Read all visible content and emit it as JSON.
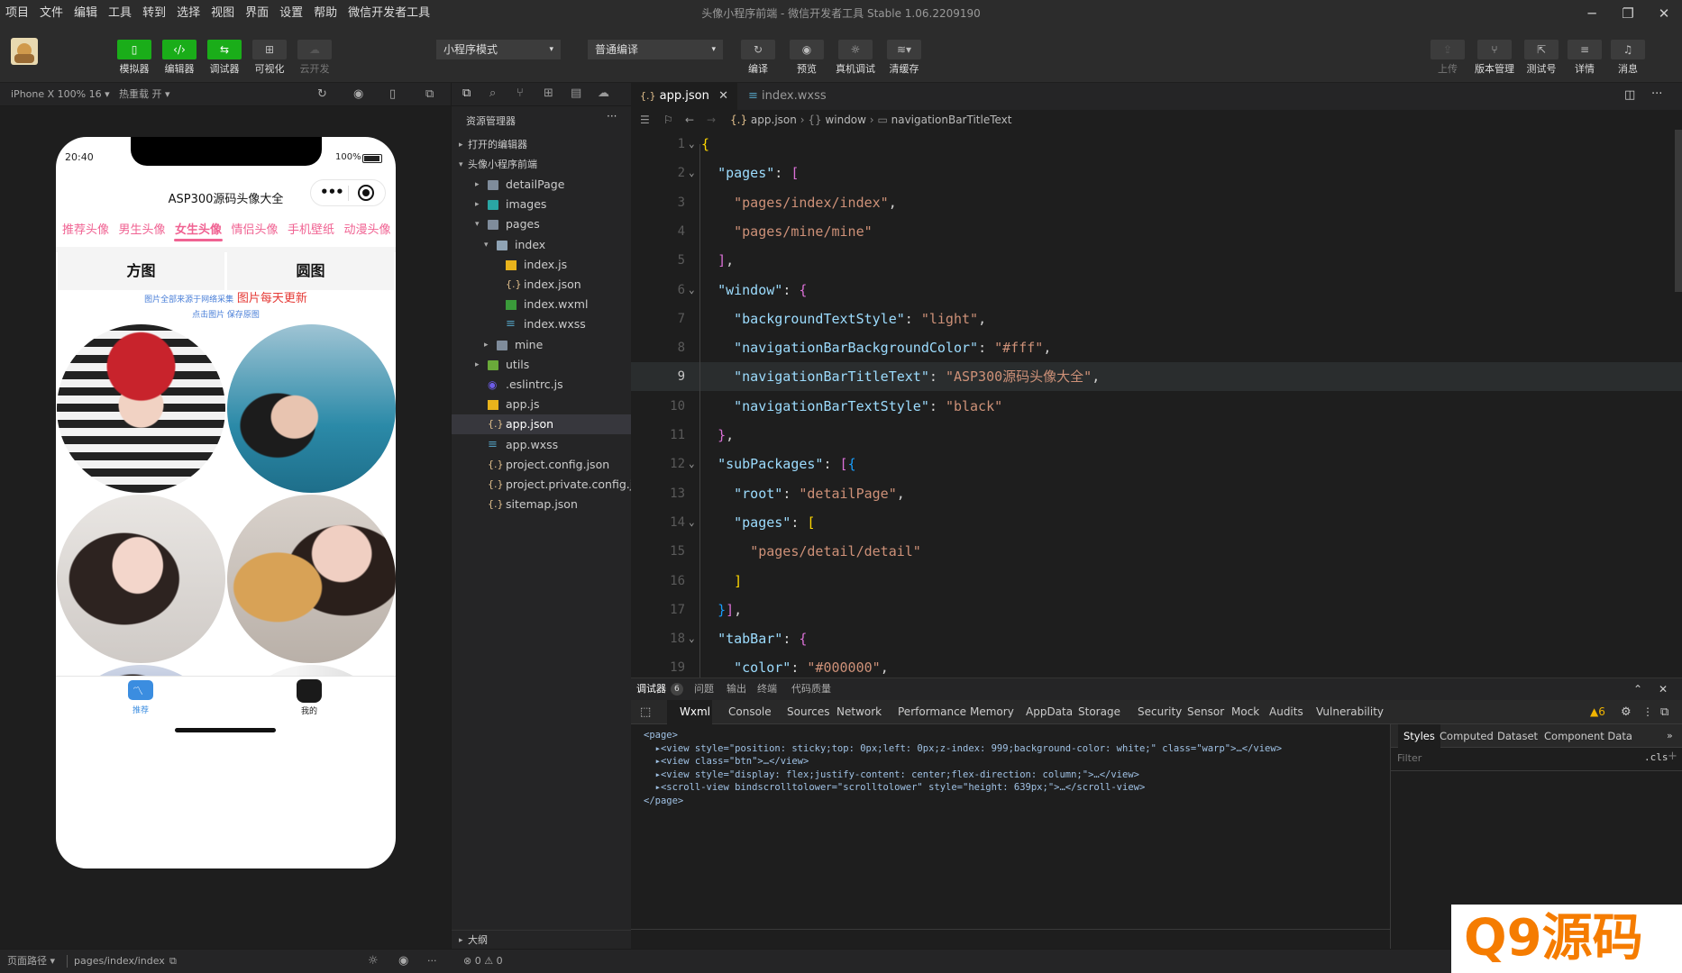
{
  "menu": [
    "项目",
    "文件",
    "编辑",
    "工具",
    "转到",
    "选择",
    "视图",
    "界面",
    "设置",
    "帮助",
    "微信开发者工具"
  ],
  "window_title": "头像小程序前端 - 微信开发者工具 Stable 1.06.2209190",
  "toolbar": {
    "left": [
      {
        "label": "模拟器",
        "icon": "phone-icon"
      },
      {
        "label": "编辑器",
        "icon": "code-icon"
      },
      {
        "label": "调试器",
        "icon": "debug-icon"
      },
      {
        "label": "可视化",
        "icon": "layout-icon"
      },
      {
        "label": "云开发",
        "icon": "cloud-icon"
      }
    ],
    "mode": "小程序模式",
    "compile": "普通编译",
    "mid": [
      {
        "label": "编译",
        "icon": "refresh-icon"
      },
      {
        "label": "预览",
        "icon": "eye-icon"
      },
      {
        "label": "真机调试",
        "icon": "bug-icon"
      },
      {
        "label": "清缓存",
        "icon": "layers-icon"
      }
    ],
    "right": [
      {
        "label": "上传",
        "icon": "upload-icon"
      },
      {
        "label": "版本管理",
        "icon": "branch-icon"
      },
      {
        "label": "测试号",
        "icon": "external-icon"
      },
      {
        "label": "详情",
        "icon": "menu-icon"
      },
      {
        "label": "消息",
        "icon": "bell-icon"
      }
    ]
  },
  "simulator": {
    "device": "iPhone X 100% 16 ▾",
    "hotreload": "热重载 开 ▾"
  },
  "phone": {
    "time": "20:40",
    "battery": "100%",
    "nav_title": "ASP300源码头像大全",
    "categories": [
      "推荐头像",
      "男生头像",
      "女生头像",
      "情侣头像",
      "手机壁纸",
      "动漫头像"
    ],
    "active_category": 2,
    "shapes": [
      "方图",
      "圆图"
    ],
    "note1a": "图片全部来源于网络采集",
    "note1b": "图片每天更新",
    "note2": "点击图片 保存原图",
    "tabs": [
      "推荐",
      "我的"
    ]
  },
  "explorer": {
    "title": "资源管理器",
    "open_editors": "打开的编辑器",
    "project": "头像小程序前端",
    "items": [
      {
        "name": "detailPage",
        "type": "folder",
        "depth": 1,
        "collapsed": true
      },
      {
        "name": "images",
        "type": "folder-img",
        "depth": 1,
        "collapsed": true
      },
      {
        "name": "pages",
        "type": "folder",
        "depth": 1,
        "collapsed": false
      },
      {
        "name": "index",
        "type": "folder-open",
        "depth": 2,
        "collapsed": false
      },
      {
        "name": "index.js",
        "type": "js",
        "depth": 3
      },
      {
        "name": "index.json",
        "type": "json",
        "depth": 3
      },
      {
        "name": "index.wxml",
        "type": "wxml",
        "depth": 3
      },
      {
        "name": "index.wxss",
        "type": "wxss",
        "depth": 3
      },
      {
        "name": "mine",
        "type": "folder",
        "depth": 2,
        "collapsed": true
      },
      {
        "name": "utils",
        "type": "folder-util",
        "depth": 1,
        "collapsed": true
      },
      {
        "name": ".eslintrc.js",
        "type": "eslint",
        "depth": 1
      },
      {
        "name": "app.js",
        "type": "js",
        "depth": 1
      },
      {
        "name": "app.json",
        "type": "json",
        "depth": 1,
        "active": true
      },
      {
        "name": "app.wxss",
        "type": "wxss",
        "depth": 1
      },
      {
        "name": "project.config.json",
        "type": "json",
        "depth": 1
      },
      {
        "name": "project.private.config.js...",
        "type": "json",
        "depth": 1
      },
      {
        "name": "sitemap.json",
        "type": "json",
        "depth": 1
      }
    ],
    "outline": "大纲"
  },
  "editor": {
    "tabs": [
      {
        "name": "app.json",
        "active": true
      },
      {
        "name": "index.wxss",
        "active": false
      }
    ],
    "breadcrumb": [
      "app.json",
      "window",
      "navigationBarTitleText"
    ],
    "current_line": 9,
    "lines": [
      [
        {
          "t": "{",
          "c": "b1"
        }
      ],
      [
        {
          "t": "  "
        },
        {
          "t": "\"pages\"",
          "c": "k"
        },
        {
          "t": ": ",
          "c": "p"
        },
        {
          "t": "[",
          "c": "b2"
        }
      ],
      [
        {
          "t": "    "
        },
        {
          "t": "\"pages/index/index\"",
          "c": "s"
        },
        {
          "t": ",",
          "c": "p"
        }
      ],
      [
        {
          "t": "    "
        },
        {
          "t": "\"pages/mine/mine\"",
          "c": "s"
        }
      ],
      [
        {
          "t": "  "
        },
        {
          "t": "]",
          "c": "b2"
        },
        {
          "t": ",",
          "c": "p"
        }
      ],
      [
        {
          "t": "  "
        },
        {
          "t": "\"window\"",
          "c": "k"
        },
        {
          "t": ": ",
          "c": "p"
        },
        {
          "t": "{",
          "c": "b2"
        }
      ],
      [
        {
          "t": "    "
        },
        {
          "t": "\"backgroundTextStyle\"",
          "c": "k"
        },
        {
          "t": ": ",
          "c": "p"
        },
        {
          "t": "\"light\"",
          "c": "s"
        },
        {
          "t": ",",
          "c": "p"
        }
      ],
      [
        {
          "t": "    "
        },
        {
          "t": "\"navigationBarBackgroundColor\"",
          "c": "k"
        },
        {
          "t": ": ",
          "c": "p"
        },
        {
          "t": "\"#fff\"",
          "c": "s"
        },
        {
          "t": ",",
          "c": "p"
        }
      ],
      [
        {
          "t": "    "
        },
        {
          "t": "\"navigationBarTitleText\"",
          "c": "k"
        },
        {
          "t": ": ",
          "c": "p"
        },
        {
          "t": "\"ASP300源码头像大全\"",
          "c": "s"
        },
        {
          "t": ",",
          "c": "p"
        }
      ],
      [
        {
          "t": "    "
        },
        {
          "t": "\"navigationBarTextStyle\"",
          "c": "k"
        },
        {
          "t": ": ",
          "c": "p"
        },
        {
          "t": "\"black\"",
          "c": "s"
        }
      ],
      [
        {
          "t": "  "
        },
        {
          "t": "}",
          "c": "b2"
        },
        {
          "t": ",",
          "c": "p"
        }
      ],
      [
        {
          "t": "  "
        },
        {
          "t": "\"subPackages\"",
          "c": "k"
        },
        {
          "t": ": ",
          "c": "p"
        },
        {
          "t": "[",
          "c": "b2"
        },
        {
          "t": "{",
          "c": "b3"
        }
      ],
      [
        {
          "t": "    "
        },
        {
          "t": "\"root\"",
          "c": "k"
        },
        {
          "t": ": ",
          "c": "p"
        },
        {
          "t": "\"detailPage\"",
          "c": "s"
        },
        {
          "t": ",",
          "c": "p"
        }
      ],
      [
        {
          "t": "    "
        },
        {
          "t": "\"pages\"",
          "c": "k"
        },
        {
          "t": ": ",
          "c": "p"
        },
        {
          "t": "[",
          "c": "b1"
        }
      ],
      [
        {
          "t": "      "
        },
        {
          "t": "\"pages/detail/detail\"",
          "c": "s"
        }
      ],
      [
        {
          "t": "    "
        },
        {
          "t": "]",
          "c": "b1"
        }
      ],
      [
        {
          "t": "  "
        },
        {
          "t": "}",
          "c": "b3"
        },
        {
          "t": "]",
          "c": "b2"
        },
        {
          "t": ",",
          "c": "p"
        }
      ],
      [
        {
          "t": "  "
        },
        {
          "t": "\"tabBar\"",
          "c": "k"
        },
        {
          "t": ": ",
          "c": "p"
        },
        {
          "t": "{",
          "c": "b2"
        }
      ],
      [
        {
          "t": "    "
        },
        {
          "t": "\"color\"",
          "c": "k"
        },
        {
          "t": ": ",
          "c": "p"
        },
        {
          "t": "\"#000000\"",
          "c": "s"
        },
        {
          "t": ",",
          "c": "p"
        }
      ]
    ]
  },
  "debugger": {
    "tabs": [
      "调试器",
      "问题",
      "输出",
      "终端",
      "代码质量"
    ],
    "badge": "6",
    "devtools": [
      "Wxml",
      "Console",
      "Sources",
      "Network",
      "Performance",
      "Memory",
      "AppData",
      "Storage",
      "Security",
      "Sensor",
      "Mock",
      "Audits",
      "Vulnerability"
    ],
    "warnings": "▲6",
    "styles_tabs": [
      "Styles",
      "Computed",
      "Dataset",
      "Component Data"
    ],
    "filter": "Filter",
    "cls": ".cls",
    "xml": [
      "<page>",
      "  ▸<view style=\"position: sticky;top: 0px;left: 0px;z-index: 999;background-color: white;\" class=\"warp\">…</view>",
      "  ▸<view class=\"btn\">…</view>",
      "  ▸<view style=\"display: flex;justify-content: center;flex-direction: column;\">…</view>",
      "  ▸<scroll-view bindscrolltolower=\"scrolltolower\" style=\"height: 639px;\">…</scroll-view>",
      "</page>"
    ]
  },
  "status": {
    "path_label": "页面路径 ▾",
    "path": "pages/index/index",
    "errors": "⊗ 0 ⚠ 0"
  },
  "watermark": "Q9源码",
  "colors": {
    "accent": "#1aad19",
    "pink": "#f06292",
    "link": "#4a7fd8"
  }
}
